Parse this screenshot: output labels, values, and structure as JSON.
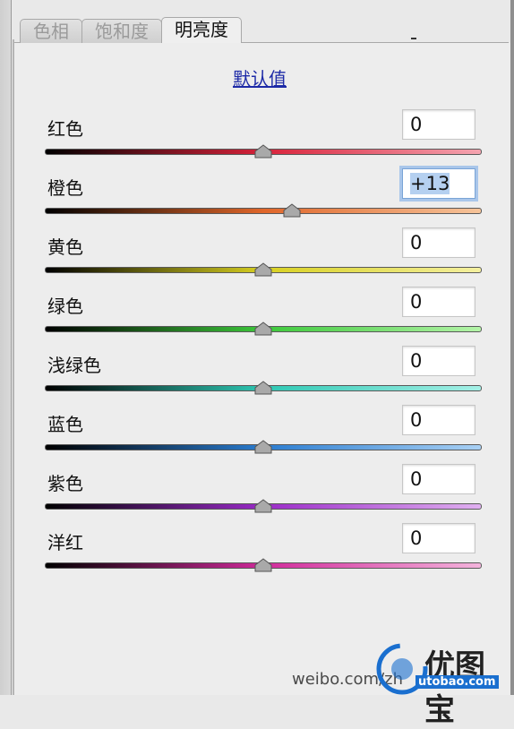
{
  "tabs": [
    {
      "label": "色相"
    },
    {
      "label": "饱和度"
    },
    {
      "label": "明亮度"
    }
  ],
  "default_link": "默认值",
  "rows": [
    {
      "label": "红色",
      "value": "0",
      "slider_value": 0,
      "colors": [
        "#000000",
        "#d8223a",
        "#f4a4b0"
      ]
    },
    {
      "label": "橙色",
      "value": "+13",
      "slider_value": 13,
      "colors": [
        "#000000",
        "#e0662a",
        "#f6c49a"
      ]
    },
    {
      "label": "黄色",
      "value": "0",
      "slider_value": 0,
      "colors": [
        "#000000",
        "#d8d020",
        "#f4f0a0"
      ]
    },
    {
      "label": "绿色",
      "value": "0",
      "slider_value": 0,
      "colors": [
        "#000000",
        "#3cc83a",
        "#b4f4a8"
      ]
    },
    {
      "label": "浅绿色",
      "value": "0",
      "slider_value": 0,
      "colors": [
        "#000000",
        "#2ec8b4",
        "#a4f0e6"
      ]
    },
    {
      "label": "蓝色",
      "value": "0",
      "slider_value": 0,
      "colors": [
        "#000000",
        "#2a7cd0",
        "#a8d0f4"
      ]
    },
    {
      "label": "紫色",
      "value": "0",
      "slider_value": 0,
      "colors": [
        "#000000",
        "#9a2ac8",
        "#e0b0f0"
      ]
    },
    {
      "label": "洋红",
      "value": "0",
      "slider_value": 0,
      "colors": [
        "#000000",
        "#d02a9a",
        "#f4b4dc"
      ]
    }
  ],
  "slider_range": [
    -100,
    100
  ],
  "watermark": "weibo.com/zh",
  "logo": {
    "name": "优图宝",
    "url": "utobao.com"
  }
}
